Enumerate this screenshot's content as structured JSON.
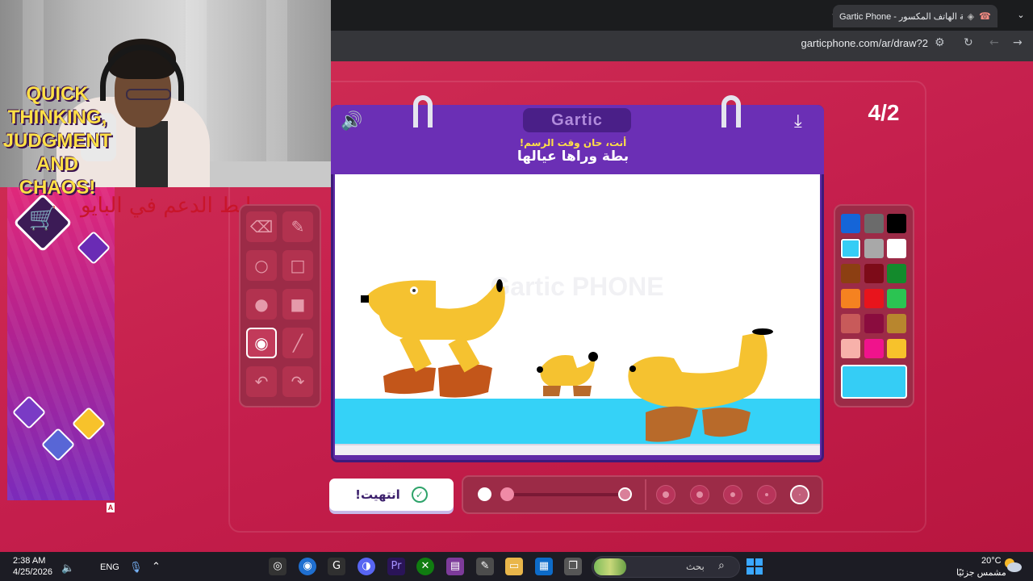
{
  "browser": {
    "tab_title": "Gartic Phone - لعبة الهاتف المكسور",
    "tab_icon": "phone-icon",
    "url": "garticphone.com/ar/draw?2",
    "new_tab_label": "+",
    "close_tab_label": "✕"
  },
  "overlay_text": "رابط الدعم في البايو",
  "ad": {
    "headline": "QUICK THINKING, JUDGMENT AND CHAOS!",
    "badge": "A"
  },
  "game": {
    "logo": "Gartic",
    "prompt_hint": "أنت، حان وقت الرسم!",
    "prompt": "بطة وراها عيالها",
    "round": "4/2",
    "canvas_watermark": "Gartic PHONE",
    "done_button": "انتهيت!",
    "selected_tool": "fill-bucket",
    "tools": [
      {
        "id": "eraser",
        "icon": "eraser-icon",
        "glyph": "⌫"
      },
      {
        "id": "pencil",
        "icon": "pencil-icon",
        "glyph": "✎"
      },
      {
        "id": "ellipse",
        "icon": "circle-outline-icon",
        "glyph": "○"
      },
      {
        "id": "rectangle",
        "icon": "square-outline-icon",
        "glyph": "□"
      },
      {
        "id": "filled-ellipse",
        "icon": "circle-filled-icon",
        "glyph": "●"
      },
      {
        "id": "filled-rectangle",
        "icon": "square-filled-icon",
        "glyph": "■"
      },
      {
        "id": "fill-bucket",
        "icon": "paint-bucket-icon",
        "glyph": "◉"
      },
      {
        "id": "line",
        "icon": "line-icon",
        "glyph": "╱"
      },
      {
        "id": "undo",
        "icon": "undo-icon",
        "glyph": "↶"
      },
      {
        "id": "redo",
        "icon": "redo-icon",
        "glyph": "↷"
      }
    ],
    "palette": [
      "#1565d8",
      "#6b6b6b",
      "#000000",
      "#35cdf5",
      "#a8a8a8",
      "#ffffff",
      "#8c3f12",
      "#7d0b18",
      "#138a2c",
      "#f58220",
      "#e8141c",
      "#2bc452",
      "#c85a5a",
      "#8a0c3e",
      "#b8862e",
      "#f7b1aa",
      "#f0138c",
      "#f7c22b"
    ],
    "selected_color": "#35cdf5",
    "brush_opacity_level": 0.0,
    "selected_brush_size": 5
  },
  "taskbar": {
    "time": "2:38 AM",
    "date": "4/25/2026",
    "language": "ENG",
    "search_placeholder": "بحث",
    "weather_temp": "20°C",
    "weather_desc": "مشمس جزئيًا"
  }
}
